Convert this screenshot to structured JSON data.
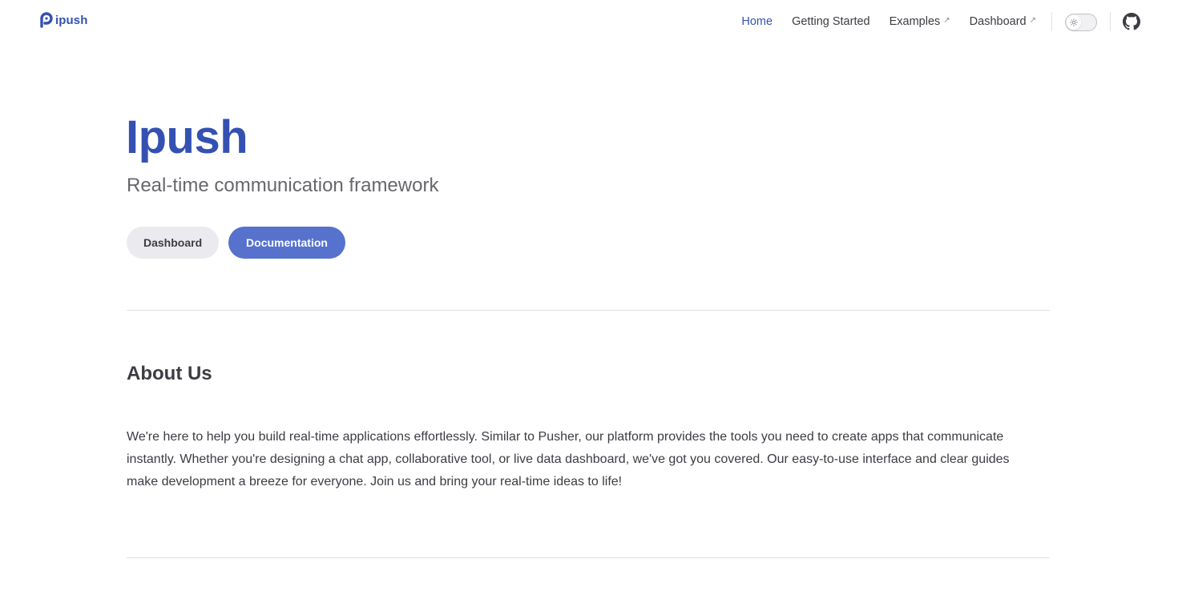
{
  "nav": {
    "logo_text": "ipush",
    "links": [
      {
        "label": "Home",
        "active": true,
        "external": false
      },
      {
        "label": "Getting Started",
        "active": false,
        "external": false
      },
      {
        "label": "Examples",
        "active": false,
        "external": true
      },
      {
        "label": "Dashboard",
        "active": false,
        "external": true
      }
    ],
    "external_icon": "↗",
    "theme_toggle_icon": "sun-icon",
    "github_icon": "github-icon"
  },
  "hero": {
    "title": "Ipush",
    "tagline": "Real-time communication framework",
    "actions": [
      {
        "label": "Dashboard",
        "style": "secondary"
      },
      {
        "label": "Documentation",
        "style": "primary"
      }
    ]
  },
  "about": {
    "title": "About Us",
    "body": "We're here to help you build real-time applications effortlessly. Similar to Pusher, our platform provides the tools you need to create apps that communicate instantly. Whether you're designing a chat app, collaborative tool, or live data dashboard, we've got you covered. Our easy-to-use interface and clear guides make development a breeze for everyone. Join us and bring your real-time ideas to life!"
  },
  "colors": {
    "brand": "#3451b2",
    "primary_button": "#5672cd",
    "secondary_button": "#ebebef",
    "text": "#3c3c43",
    "muted_text": "#67676c",
    "divider": "#e2e2e3"
  }
}
